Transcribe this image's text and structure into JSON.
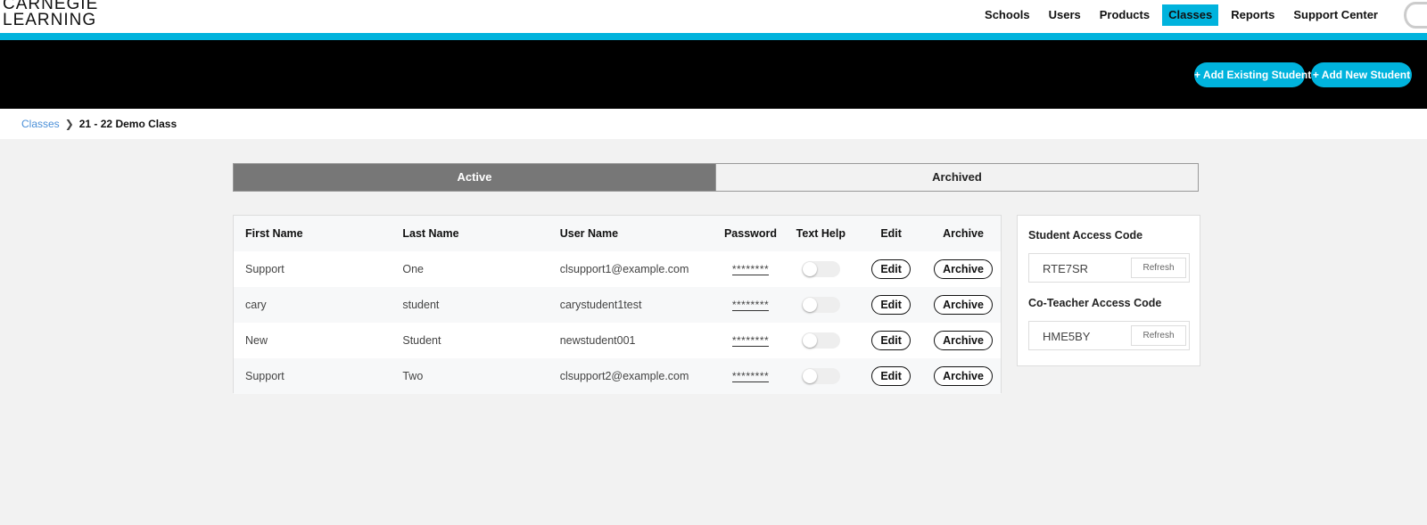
{
  "brand": {
    "line1": "CARNEGIE",
    "line2": "LEARNING"
  },
  "nav": {
    "items": [
      {
        "label": "Schools",
        "active": false
      },
      {
        "label": "Users",
        "active": false
      },
      {
        "label": "Products",
        "active": false
      },
      {
        "label": "Classes",
        "active": true
      },
      {
        "label": "Reports",
        "active": false
      },
      {
        "label": "Support Center",
        "active": false
      }
    ]
  },
  "header_actions": {
    "add_existing": "+ Add Existing Student",
    "add_new": "+ Add New Student"
  },
  "breadcrumb": {
    "parent": "Classes",
    "current": "21 - 22 Demo Class"
  },
  "tabs": [
    {
      "label": "Active",
      "active": true
    },
    {
      "label": "Archived",
      "active": false
    }
  ],
  "table": {
    "columns": [
      "First Name",
      "Last Name",
      "User Name",
      "Password",
      "Text Help",
      "Edit",
      "Archive"
    ],
    "rows": [
      {
        "first": "Support",
        "last": "One",
        "username": "clsupport1@example.com",
        "password": "********",
        "text_help": false,
        "edit": "Edit",
        "archive": "Archive"
      },
      {
        "first": "cary",
        "last": "student",
        "username": "carystudent1test",
        "password": "********",
        "text_help": false,
        "edit": "Edit",
        "archive": "Archive"
      },
      {
        "first": "New",
        "last": "Student",
        "username": "newstudent001",
        "password": "********",
        "text_help": false,
        "edit": "Edit",
        "archive": "Archive"
      },
      {
        "first": "Support",
        "last": "Two",
        "username": "clsupport2@example.com",
        "password": "********",
        "text_help": false,
        "edit": "Edit",
        "archive": "Archive"
      }
    ]
  },
  "access_codes": {
    "student": {
      "label": "Student Access Code",
      "code": "RTE7SR",
      "refresh": "Refresh"
    },
    "coteacher": {
      "label": "Co-Teacher Access Code",
      "code": "HME5BY",
      "refresh": "Refresh"
    }
  },
  "colors": {
    "accent": "#00b3dd",
    "header_bg": "#000000",
    "active_tab": "#777777",
    "link": "#4a8fd8"
  }
}
